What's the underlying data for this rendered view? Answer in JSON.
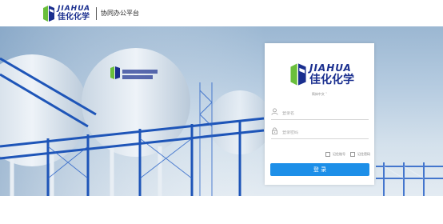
{
  "header": {
    "brand_en": "JIAHUA",
    "brand_cn": "佳化化学",
    "system_title": "协同办公平台"
  },
  "login": {
    "brand_en": "JIAHUA",
    "brand_cn": "佳化化学",
    "language": "简体中文 ˅",
    "username_placeholder": "登录名",
    "password_placeholder": "登录密码",
    "remember_account": "记住账号",
    "remember_password": "记住密码",
    "submit_label": "登 录"
  },
  "colors": {
    "brand_blue": "#1a2f8f",
    "brand_green": "#6abf3b",
    "button_blue": "#1d8fe8"
  }
}
